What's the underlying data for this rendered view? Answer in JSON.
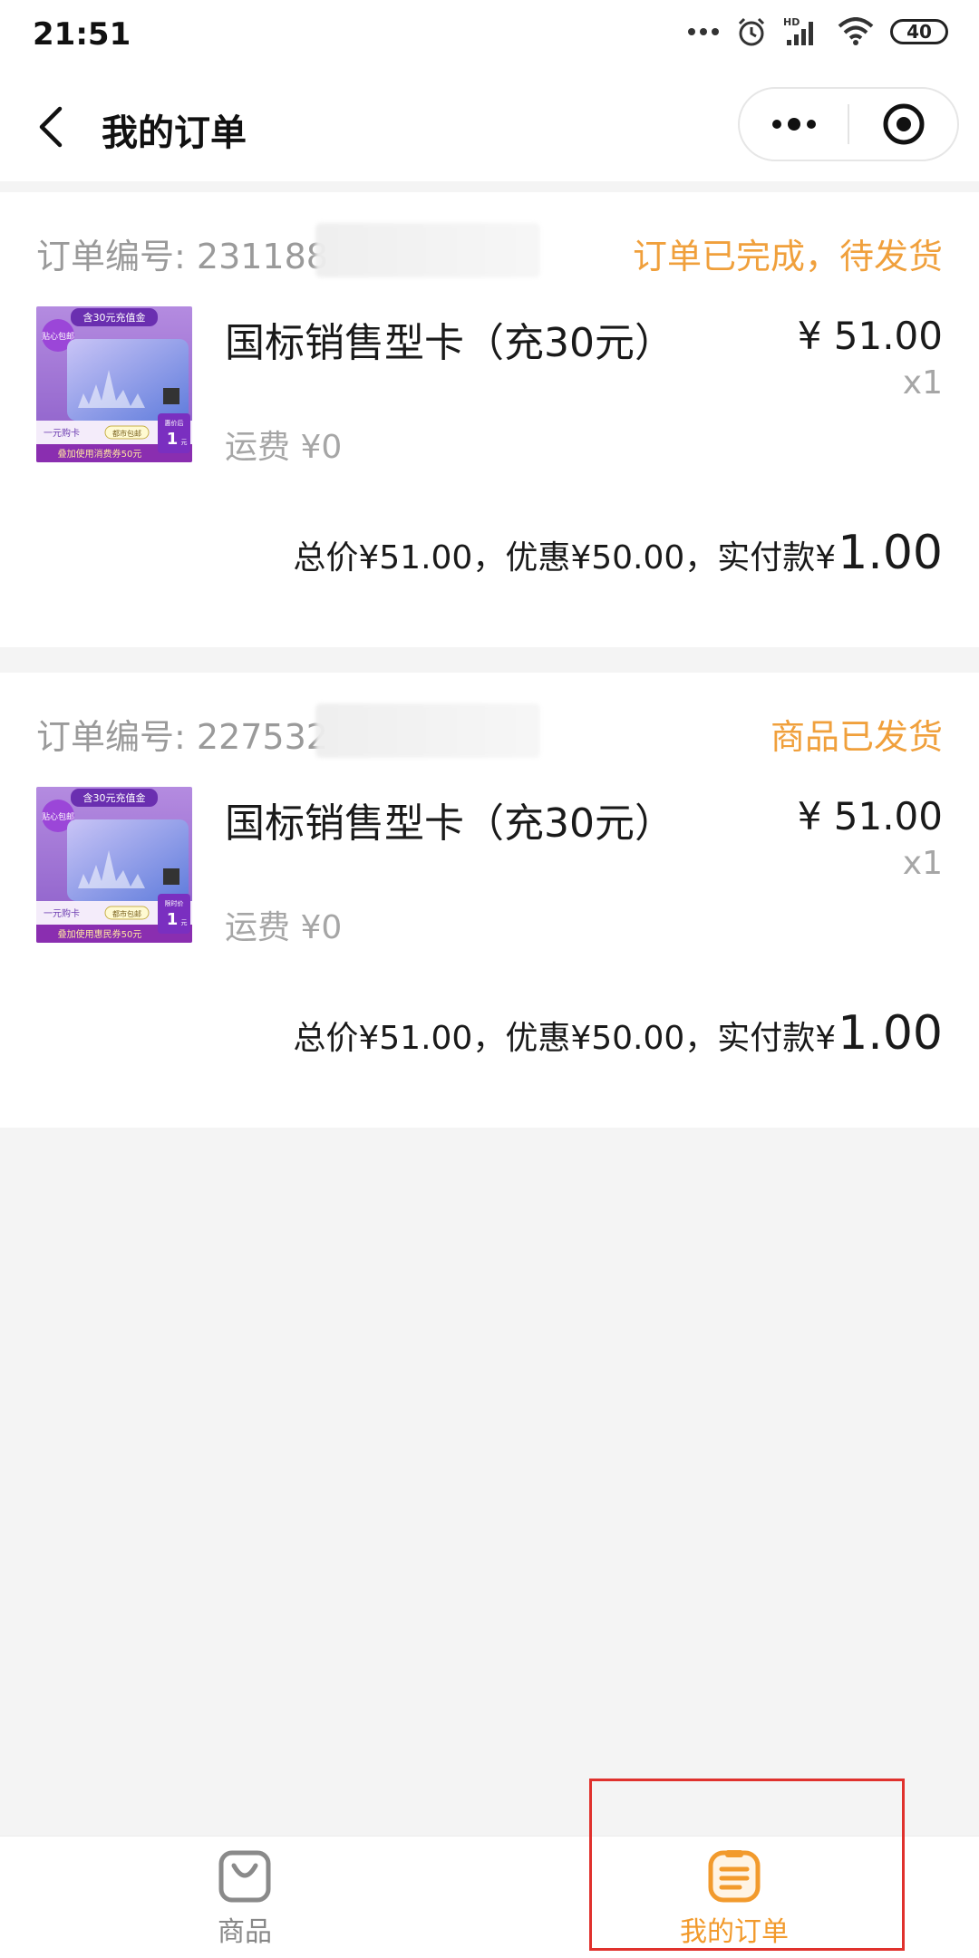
{
  "status_bar": {
    "time": "21:51",
    "network_label": "HD",
    "battery": "40"
  },
  "header": {
    "title": "我的订单"
  },
  "orders": [
    {
      "order_no_label": "订单编号:",
      "order_no_visible": "231188",
      "status": "订单已完成，待发货",
      "status_color": "#f0a03c",
      "product_name": "国标销售型卡（充30元）",
      "price": "¥ 51.00",
      "qty": "x1",
      "shipping": "运费 ¥0",
      "summary_text": "总价¥51.00，优惠¥50.00，实付款¥",
      "paid_amount": "1.00",
      "thumb": {
        "top_banner": "含30元充值金",
        "badge": "贴心包邮",
        "left_label": "一元购卡",
        "tag": "都市包邮",
        "bottom_banner": "叠加使用消费券50元",
        "price_box_top": "惠价后",
        "price_box_value": "1",
        "price_box_unit": "元"
      }
    },
    {
      "order_no_label": "订单编号:",
      "order_no_visible": "227532",
      "status": "商品已发货",
      "status_color": "#f0a03c",
      "product_name": "国标销售型卡（充30元）",
      "price": "¥ 51.00",
      "qty": "x1",
      "shipping": "运费 ¥0",
      "summary_text": "总价¥51.00，优惠¥50.00，实付款¥",
      "paid_amount": "1.00",
      "thumb": {
        "top_banner": "含30元充值金",
        "badge": "贴心包邮",
        "left_label": "一元购卡",
        "tag": "都市包邮",
        "bottom_banner": "叠加使用惠民券50元",
        "price_box_top": "限时价",
        "price_box_value": "1",
        "price_box_unit": "元"
      }
    }
  ],
  "tabs": [
    {
      "label": "商品",
      "icon": "bag-icon",
      "active": false
    },
    {
      "label": "我的订单",
      "icon": "order-list-icon",
      "active": true
    }
  ],
  "colors": {
    "accent": "#f29a2c",
    "status": "#f0a03c",
    "highlight": "#e0312d"
  }
}
